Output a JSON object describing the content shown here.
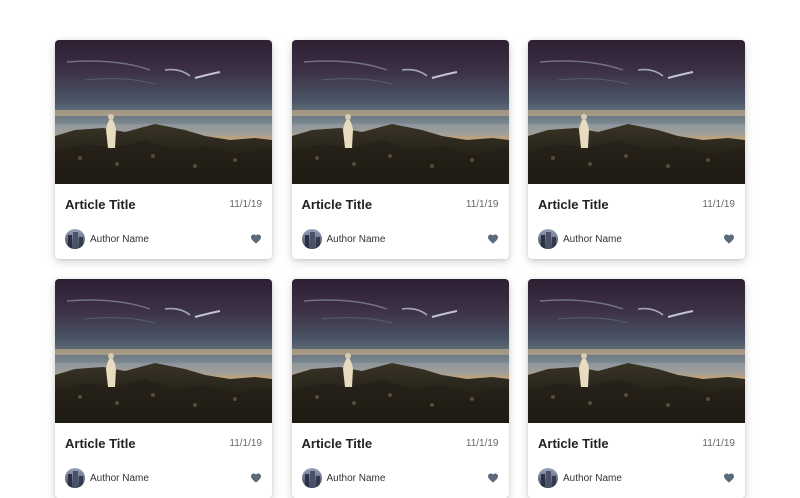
{
  "cards": [
    {
      "title": "Article Title",
      "date": "11/1/19",
      "author": "Author Name"
    },
    {
      "title": "Article Title",
      "date": "11/1/19",
      "author": "Author Name"
    },
    {
      "title": "Article Title",
      "date": "11/1/19",
      "author": "Author Name"
    },
    {
      "title": "Article Title",
      "date": "11/1/19",
      "author": "Author Name"
    },
    {
      "title": "Article Title",
      "date": "11/1/19",
      "author": "Author Name"
    },
    {
      "title": "Article Title",
      "date": "11/1/19",
      "author": "Author Name"
    }
  ],
  "icons": {
    "like": "heart-icon"
  },
  "colors": {
    "heart": "#5b6b7c",
    "title": "#222222",
    "meta": "#666666"
  }
}
